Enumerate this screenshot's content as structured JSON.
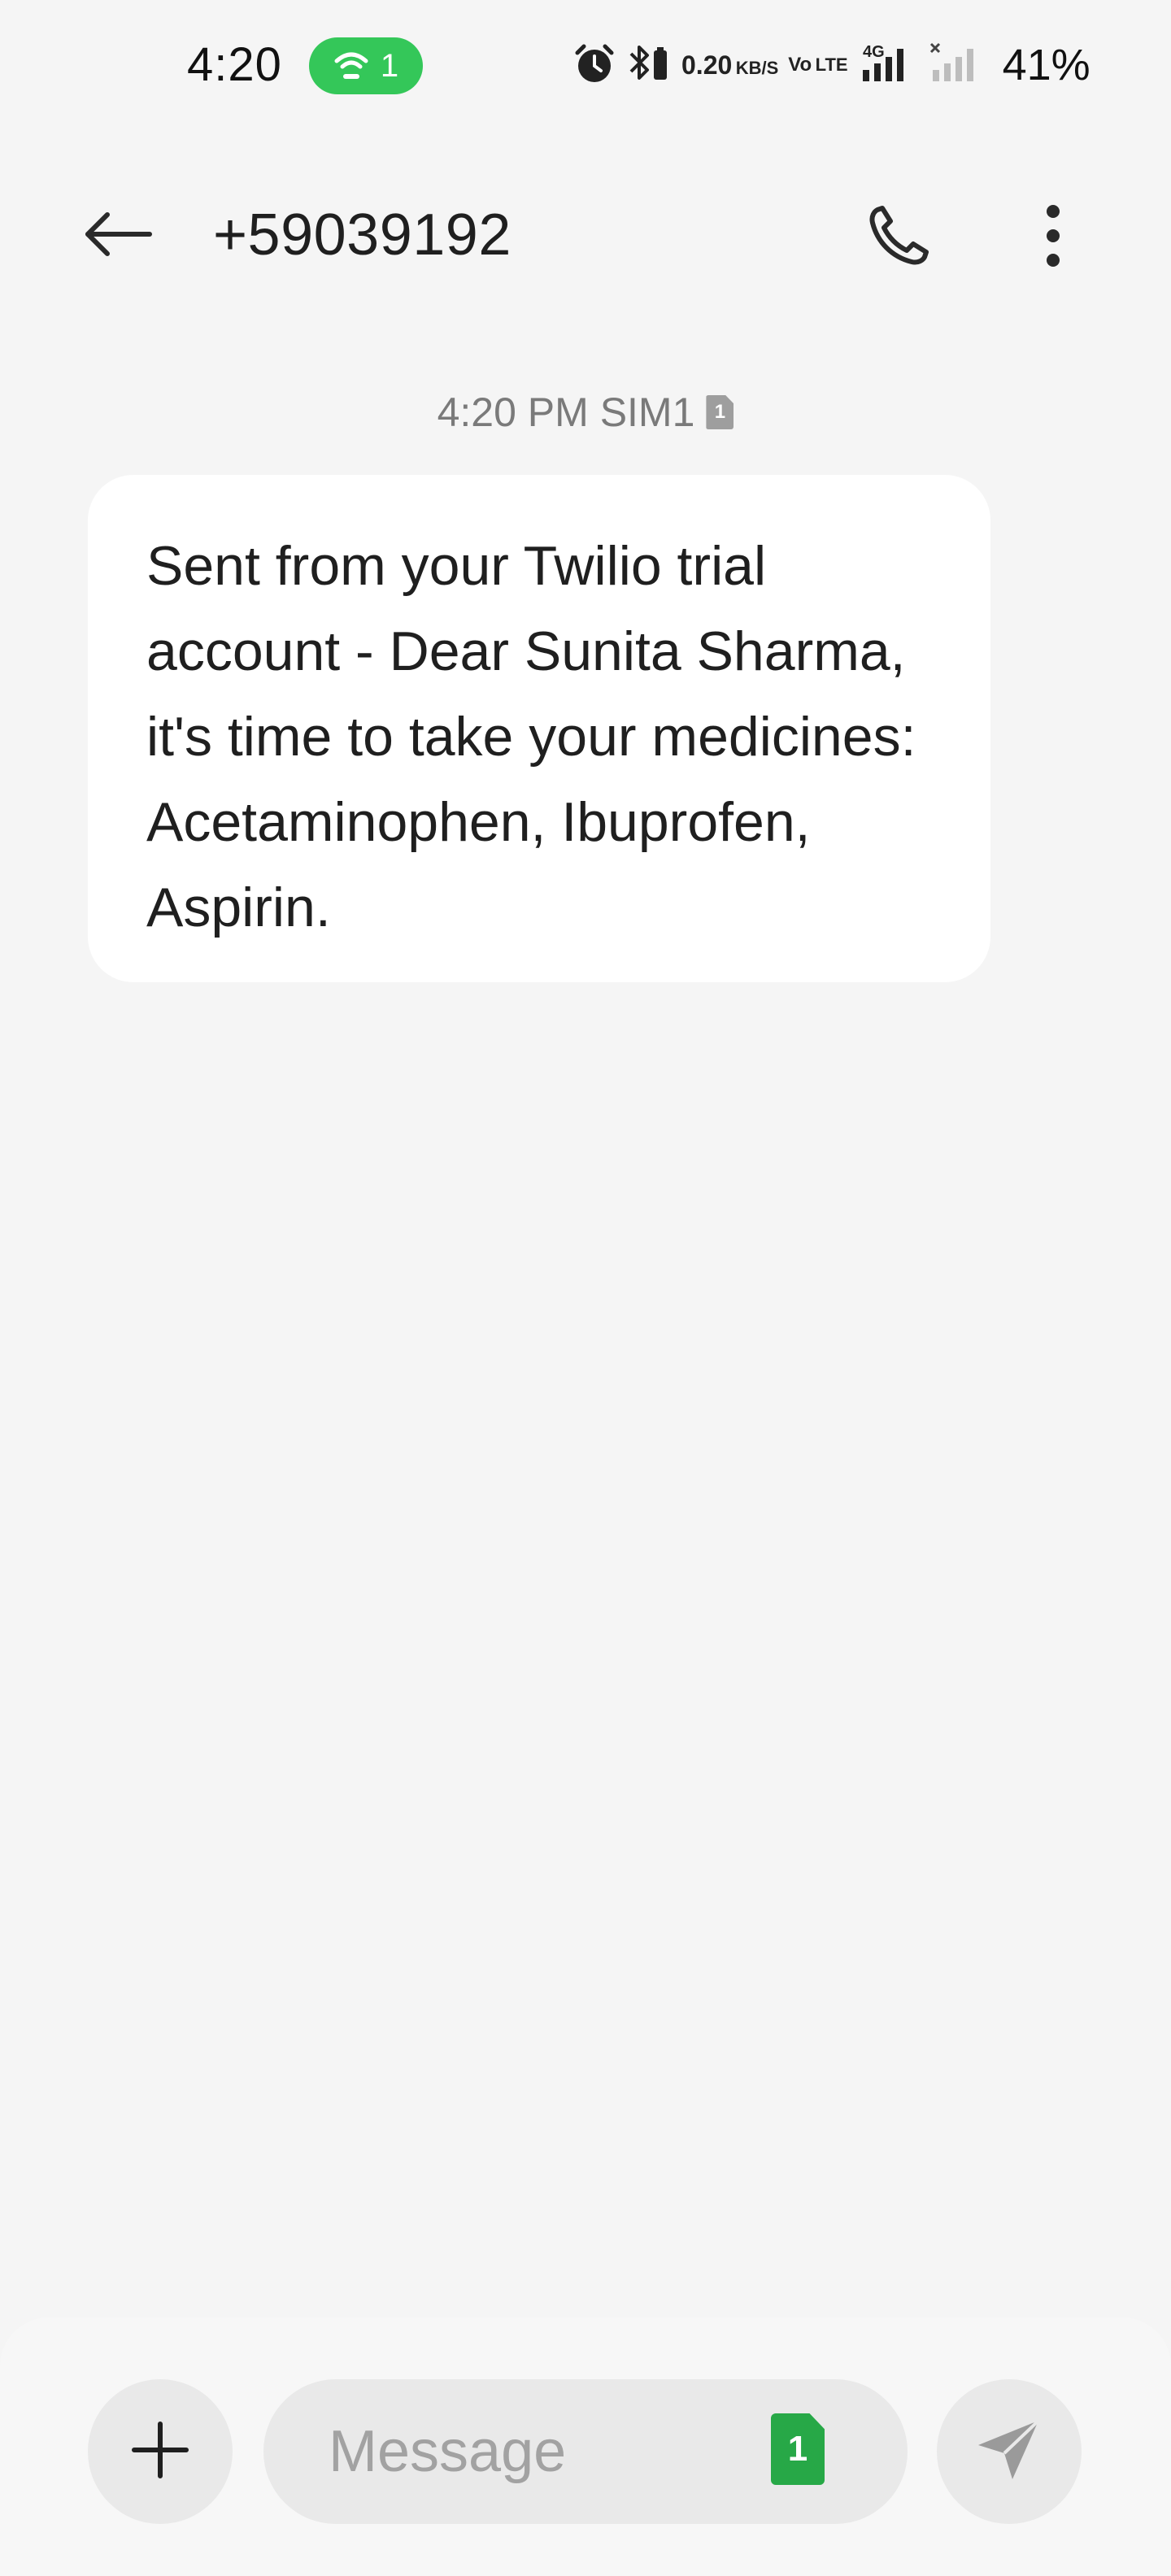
{
  "status_bar": {
    "time": "4:20",
    "hotspot_count": "1",
    "net_speed_value": "0.20",
    "net_speed_unit": "KB/S",
    "volte_top": "Vo",
    "volte_bottom": "LTE",
    "network_type": "4G",
    "battery": "41%"
  },
  "header": {
    "title": "+59039192"
  },
  "conversation": {
    "messages": [
      {
        "timestamp": "4:20 PM SIM1",
        "sim_badge": "1",
        "text": "Sent from your Twilio trial account - Dear Sunita Sharma, it's time to take your medicines: Acetaminophen, Ibuprofen, Aspirin."
      }
    ]
  },
  "composer": {
    "placeholder": "Message",
    "sim_label": "1"
  },
  "colors": {
    "background": "#f5f5f5",
    "bubble": "#ffffff",
    "hotspot_pill": "#34c759",
    "sim_badge": "#27a847",
    "composer_controls": "#e9e9e9"
  },
  "icons": {
    "back": "arrow-left-icon",
    "call": "phone-icon",
    "more": "more-vertical-icon",
    "attach": "plus-icon",
    "send": "send-icon",
    "hotspot": "hotspot-icon",
    "alarm": "alarm-icon",
    "bluetooth": "bluetooth-icon",
    "signal": "signal-icon"
  }
}
